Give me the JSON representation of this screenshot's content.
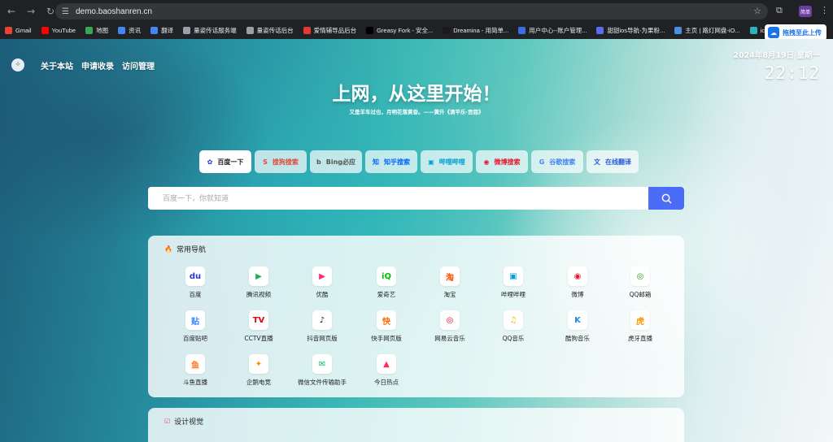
{
  "browser": {
    "url": "demo.baoshanren.cn",
    "profile_label": "简单",
    "bookmarks": [
      {
        "label": "Gmail",
        "color": "#ea4335"
      },
      {
        "label": "YouTube",
        "color": "#ff0000"
      },
      {
        "label": "地图",
        "color": "#34a853"
      },
      {
        "label": "资讯",
        "color": "#4285f4"
      },
      {
        "label": "翻译",
        "color": "#4285f4"
      },
      {
        "label": "量姿传话服务端",
        "color": "#9aa0a6"
      },
      {
        "label": "量姿传话后台",
        "color": "#9aa0a6"
      },
      {
        "label": "爱情辅导品后台",
        "color": "#e53935"
      },
      {
        "label": "Greasy Fork - 安全...",
        "color": "#000000"
      },
      {
        "label": "Dreamina - 用简单...",
        "color": "#1a1a1a"
      },
      {
        "label": "用户中心--账户管理...",
        "color": "#3a6ee8"
      },
      {
        "label": "甜甜ios导航-为果粉...",
        "color": "#5b6cf0"
      },
      {
        "label": "主页 | 路灯网盘-iO...",
        "color": "#4a90e2"
      },
      {
        "label": "iconfont-阿里巴...",
        "color": "#2bb3c0"
      }
    ],
    "upload_label": "拖拽至此上传"
  },
  "site": {
    "nav": [
      "关于本站",
      "申请收录",
      "访问管理"
    ],
    "date": "2024年8月19日 星期一",
    "time": "22:12",
    "headline": "上网，从这里开始！",
    "subline": "又是羊车过也，月明花落黄昏。——黄升《清平乐·宫怨》"
  },
  "engines": [
    {
      "label": "百度一下",
      "icon": "✿",
      "color": "#2932e1",
      "active": true,
      "width": 64
    },
    {
      "label": "搜狗搜索",
      "icon": "S",
      "color": "#e24a3c",
      "active": false,
      "width": 64
    },
    {
      "label": "Bing必应",
      "icon": "b",
      "color": "#555555",
      "active": false,
      "width": 64
    },
    {
      "label": "知乎搜索",
      "icon": "知",
      "color": "#0066ff",
      "active": false,
      "width": 64
    },
    {
      "label": "哔哩哔哩",
      "icon": "▣",
      "color": "#00a1d6",
      "active": false,
      "width": 64
    },
    {
      "label": "微博搜索",
      "icon": "◉",
      "color": "#e6162d",
      "active": false,
      "width": 64
    },
    {
      "label": "谷歌搜索",
      "icon": "G",
      "color": "#4285f4",
      "active": false,
      "width": 64
    },
    {
      "label": "在线翻译",
      "icon": "文",
      "color": "#2c5bd6",
      "active": false,
      "width": 64
    }
  ],
  "search": {
    "placeholder": "百度一下，你就知道"
  },
  "panels": {
    "common_title": "常用导航",
    "design_title": "设计视觉"
  },
  "common_nav": [
    {
      "label": "百度",
      "icon": "du",
      "color": "#2932e1"
    },
    {
      "label": "腾讯视频",
      "icon": "▶",
      "color": "#1fb24c"
    },
    {
      "label": "优酷",
      "icon": "▶",
      "color": "#ff2a6d"
    },
    {
      "label": "爱奇艺",
      "icon": "iQ",
      "color": "#00be06"
    },
    {
      "label": "淘宝",
      "icon": "淘",
      "color": "#ff5000"
    },
    {
      "label": "哔哩哔哩",
      "icon": "▣",
      "color": "#00a1d6"
    },
    {
      "label": "微博",
      "icon": "◉",
      "color": "#e6162d"
    },
    {
      "label": "QQ邮箱",
      "icon": "◎",
      "color": "#2aa515"
    },
    {
      "label": "百度贴吧",
      "icon": "贴",
      "color": "#3388ff"
    },
    {
      "label": "CCTV直播",
      "icon": "TV",
      "color": "#e60012"
    },
    {
      "label": "抖音网页版",
      "icon": "♪",
      "color": "#111111"
    },
    {
      "label": "快手网页版",
      "icon": "快",
      "color": "#ff6a00"
    },
    {
      "label": "网易云音乐",
      "icon": "◎",
      "color": "#e60026"
    },
    {
      "label": "QQ音乐",
      "icon": "♫",
      "color": "#f5b800"
    },
    {
      "label": "酷狗音乐",
      "icon": "K",
      "color": "#1e88e5"
    },
    {
      "label": "虎牙直播",
      "icon": "虎",
      "color": "#ff9600"
    },
    {
      "label": "斗鱼直播",
      "icon": "鱼",
      "color": "#ff7a22"
    },
    {
      "label": "企鹅电竞",
      "icon": "✦",
      "color": "#ff8a00"
    },
    {
      "label": "微信文件传输助手",
      "icon": "✉",
      "color": "#07c160"
    },
    {
      "label": "今日热点",
      "icon": "▲",
      "color": "#fe2c55"
    }
  ]
}
